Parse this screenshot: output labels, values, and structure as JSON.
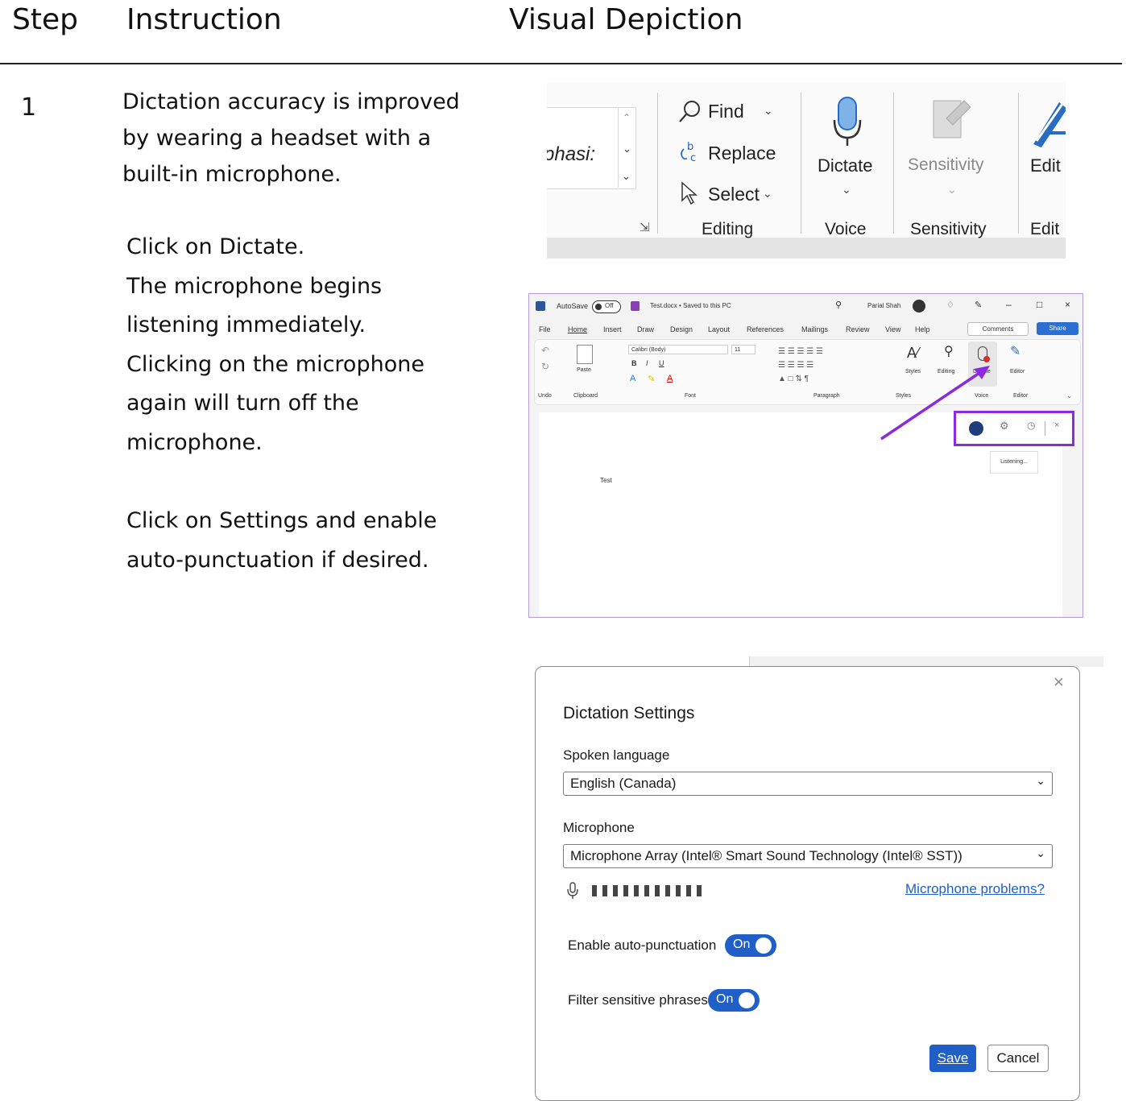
{
  "headers": {
    "step": "Step",
    "instruction": "Instruction",
    "visual": "Visual Depiction"
  },
  "step": {
    "number": "1",
    "para1": [
      "Dictation accuracy is improved",
      "by wearing a headset with a",
      "built-in microphone."
    ],
    "para2": [
      "Click on Dictate.",
      "The microphone begins",
      "listening immediately.",
      "Clicking on the microphone",
      "again will turn off the",
      "microphone."
    ],
    "para3": [
      "Click on Settings and enable",
      "auto-punctuation if desired."
    ]
  },
  "ribbon": {
    "style_fragment": "phasi:",
    "find": "Find",
    "replace": "Replace",
    "select": "Select",
    "editing_group": "Editing",
    "dictate": "Dictate",
    "voice_group": "Voice",
    "sensitivity": "Sensitivity",
    "sensitivity_group": "Sensitivity",
    "editor_fragment": "Edit",
    "editor_group": "Edit"
  },
  "word": {
    "autosave": "AutoSave",
    "autosave_state": "Off",
    "doc_title": "Test.docx • Saved to this PC",
    "user": "Parial Shah",
    "tabs": [
      "File",
      "Home",
      "Insert",
      "Draw",
      "Design",
      "Layout",
      "References",
      "Mailings",
      "Review",
      "View",
      "Help"
    ],
    "comments": "Comments",
    "share": "Share",
    "font": "Calibri (Body)",
    "font_size": "11",
    "groups": [
      "Undo",
      "Clipboard",
      "Font",
      "Paragraph",
      "Styles",
      "Voice",
      "Editor"
    ],
    "styles_btn": "Styles",
    "editing_btn": "Editing",
    "dictate_btn": "Dictate",
    "editor_btn": "Editor",
    "paste": "Paste",
    "listening": "Listening...",
    "doc_text": "Test",
    "arrow_color": "#8a2be2",
    "highlight_color": "#8a2be2"
  },
  "settings": {
    "title": "Dictation Settings",
    "spoken_language_label": "Spoken language",
    "spoken_language_value": "English (Canada)",
    "microphone_label": "Microphone",
    "microphone_value": "Microphone Array (Intel® Smart Sound Technology (Intel® SST))",
    "mic_problems_link": "Microphone problems?",
    "auto_punct_label": "Enable auto-punctuation",
    "auto_punct_state": "On",
    "filter_label": "Filter sensitive phrases",
    "filter_state": "On",
    "save": "Save",
    "cancel": "Cancel",
    "accent": "#1f5fc7"
  }
}
